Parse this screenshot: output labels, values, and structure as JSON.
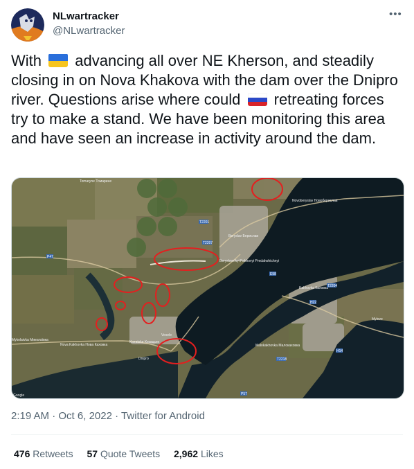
{
  "author": {
    "name": "NLwartracker",
    "handle": "@NLwartracker"
  },
  "more_icon": "more-horizontal-icon",
  "tweet": {
    "part1": "With",
    "part2": "advancing all over NE Kherson, and steadily closing in on Nova Khakova with the dam over the Dnipro river. Questions arise where could",
    "part3": "retreating forces try to make a stand. We have been monitoring this area and have seen an increase in activity around the dam.",
    "flag_ua": "ukraine-flag-icon",
    "flag_ru": "russia-flag-icon"
  },
  "map": {
    "labels": {
      "tomarine": "Tomaryne Томарине",
      "novoberyslav": "Novoberyslav Новоберислав",
      "beryslav": "Beryslav Берислав",
      "fakhovyi": "Beryslavs'kyi Fakhovyi Predahohichnyi",
      "lvove": "Lvove Львове",
      "korsunka": "Korsunka Корсунка",
      "burhunka": "Burhunka",
      "dnipro": "Dnipro",
      "mylove": "Mylove",
      "kakhovka": "Kakhovka Каховка",
      "vesele": "Vesele",
      "mykolaivka": "Mykolaivka Миколаївка",
      "khakhovka_big": "Nova Kakhovka Нова Каховка",
      "malokakhovka": "Malokakhovka Малокаховка",
      "hpp": "Kakhovka HPP Каховська ГЕС",
      "shaky": "Shakhy Шахи",
      "kozatske": "Kozatske Козацьке",
      "zmiivka": "Zmiivka Зміївка",
      "dnipriany": "Dnipriany",
      "t2201": "T2201",
      "t2207": "T2207",
      "t2204": "T2204",
      "t2215": "T2215",
      "t2218": "T2218",
      "p47": "P47",
      "h14": "H14",
      "e58": "E58",
      "h22": "H22",
      "p57": "P57",
      "google": "Google"
    }
  },
  "meta": {
    "time": "2:19 AM",
    "sep1": "·",
    "date": "Oct 6, 2022",
    "sep2": "·",
    "source": "Twitter for Android"
  },
  "stats": {
    "retweets_count": "476",
    "retweets_label": "Retweets",
    "quotes_count": "57",
    "quotes_label": "Quote Tweets",
    "likes_count": "2,962",
    "likes_label": "Likes"
  }
}
